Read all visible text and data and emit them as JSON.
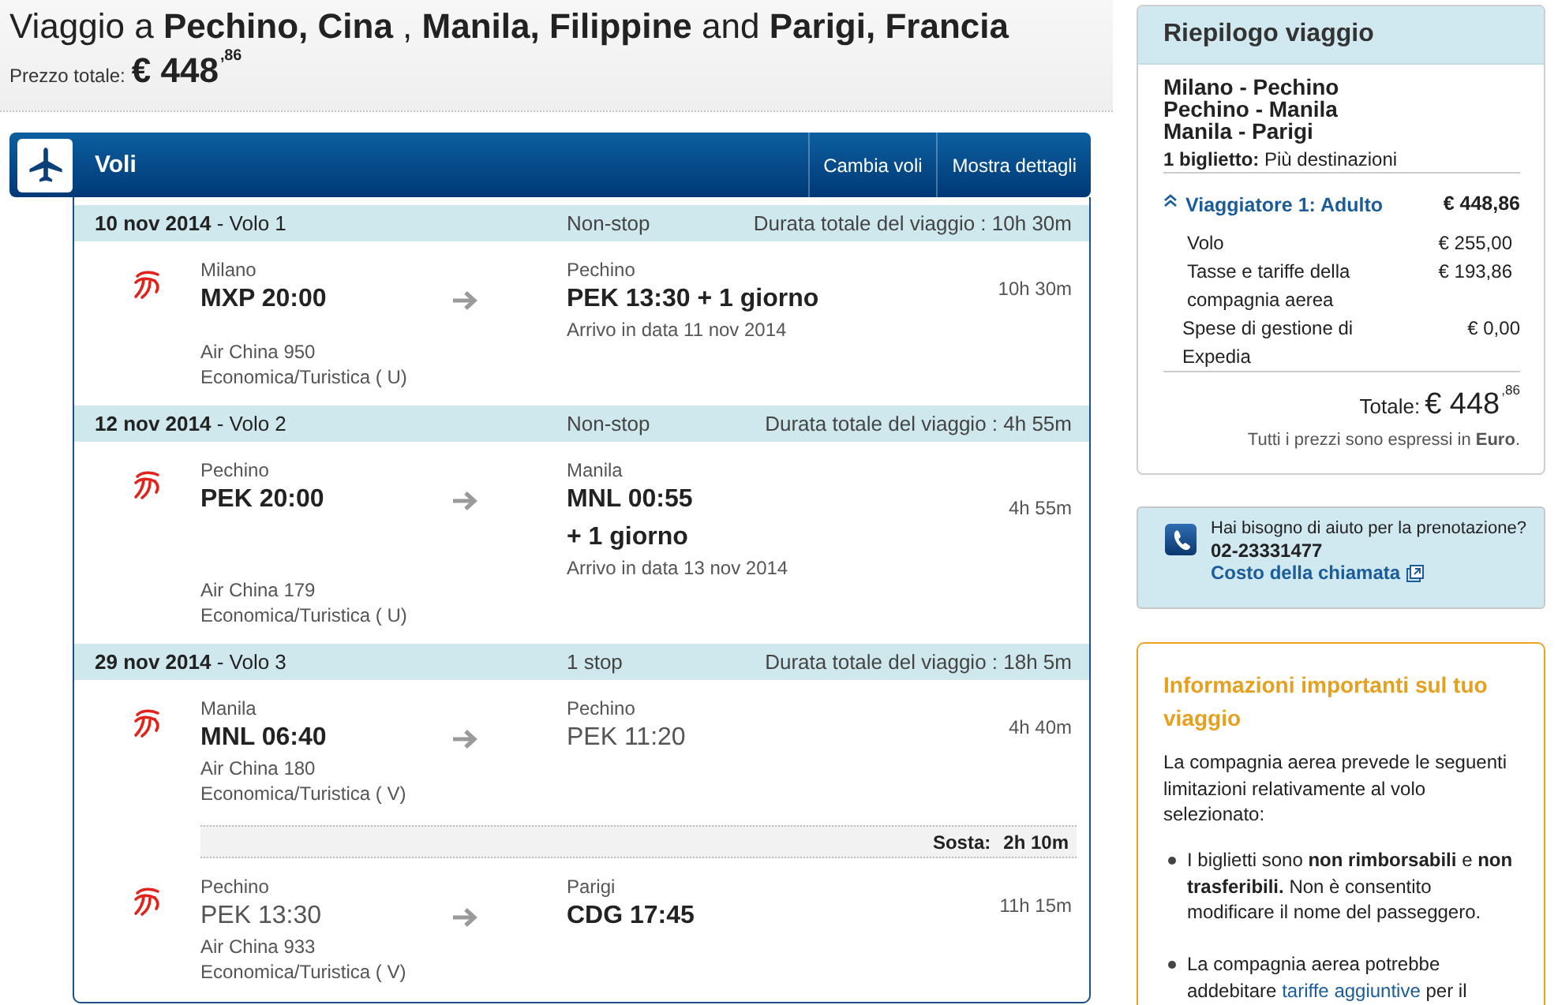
{
  "header": {
    "title": "Viaggio a **Pechino, Cina** , **Manila, Filippine** and **Parigi, Francia**",
    "price_label": "Prezzo totale:",
    "price": "€ 448$^{,86}$"
  },
  "flights_bar": {
    "title": "Voli",
    "buttons": [
      "Cambia voli",
      "Mostra dettagli"
    ]
  },
  "flights": [
    {
      "title": "**10 nov 2014** - Volo 1",
      "stops": "Non-stop",
      "total_duration": "Durata totale del viaggio : 10h 30m",
      "items": [
        {
          "kind": "leg",
          "departure": {
            "city": "Milano",
            "time": "MXP 20:00",
            "highlighted": true
          },
          "arrival": {
            "city": "Pechino",
            "time": "PEK 13:30 + 1 giorno",
            "highlighted": true,
            "note": "Arrivo in data 11 nov 2014"
          },
          "duration": "10h 30m",
          "airline": "Air China 950",
          "cabin": "Economica/Turistica ( U)"
        }
      ]
    },
    {
      "title": "**12 nov 2014** - Volo 2",
      "stops": "Non-stop",
      "total_duration": "Durata totale del viaggio : 4h 55m",
      "items": [
        {
          "kind": "leg",
          "departure": {
            "city": "Pechino",
            "time": "PEK 20:00",
            "highlighted": true
          },
          "arrival": {
            "city": "Manila",
            "time": "MNL 00:55",
            "highlighted": true,
            "next_day": "+ 1 giorno",
            "note": "Arrivo in data 13 nov 2014"
          },
          "duration": "4h 55m",
          "airline": "Air China 179",
          "cabin": "Economica/Turistica ( U)"
        }
      ]
    },
    {
      "title": "**29 nov 2014** - Volo 3",
      "stops": "1 stop",
      "total_duration": "Durata totale del viaggio : 18h 5m",
      "items": [
        {
          "kind": "leg",
          "departure": {
            "city": "Manila",
            "time": "MNL 06:40",
            "highlighted": true
          },
          "arrival": {
            "city": "Pechino",
            "time": "PEK 11:20",
            "highlighted": false
          },
          "duration": "4h 40m",
          "airline": "Air China 180",
          "cabin": "Economica/Turistica ( V)"
        },
        {
          "kind": "layover",
          "label": "Sosta:",
          "duration": "2h 10m"
        },
        {
          "kind": "leg",
          "departure": {
            "city": "Pechino",
            "time": "PEK 13:30",
            "highlighted": false
          },
          "arrival": {
            "city": "Parigi",
            "time": "CDG 17:45",
            "highlighted": true
          },
          "duration": "11h 15m",
          "airline": "Air China 933",
          "cabin": "Economica/Turistica ( V)"
        }
      ]
    }
  ],
  "summary": {
    "title": "Riepilogo viaggio",
    "routes": [
      "Milano - Pechino",
      "Pechino - Manila",
      "Manila - Parigi"
    ],
    "ticket": "**1 biglietto:** Più destinazioni",
    "traveler": {
      "label": "Viaggiatore 1: Adulto",
      "expanded": true,
      "amount": "€ 448,86"
    },
    "lines": [
      {
        "label": "Volo",
        "amount": "€ 255,00"
      },
      {
        "label": "Tasse e tariffe della compagnia aerea",
        "amount": "€ 193,86"
      }
    ],
    "fee": {
      "label": "Spese di gestione di Expedia",
      "amount": "€ 0,00"
    },
    "total_label": "Totale:",
    "total": "€ 448$^{,86}$",
    "note": "Tutti i prezzi sono espressi in **Euro**."
  },
  "help": {
    "question": "Hai bisogno di aiuto per la prenotazione?",
    "phone": "02-23331477",
    "link": "Costo della chiamata"
  },
  "info": {
    "title": "Informazioni importanti sul tuo viaggio",
    "intro": "La compagnia aerea prevede le seguenti limitazioni relativamente al volo selezionato:",
    "bullets": [
      {
        "text": "I biglietti sono **non rimborsabili** e **non trasferibili.** Non è consentito modificare il nome del passeggero."
      },
      {
        "text": "La compagnia aerea potrebbe addebitare",
        "link": "tariffe aggiuntive",
        "after": "per il"
      }
    ]
  }
}
